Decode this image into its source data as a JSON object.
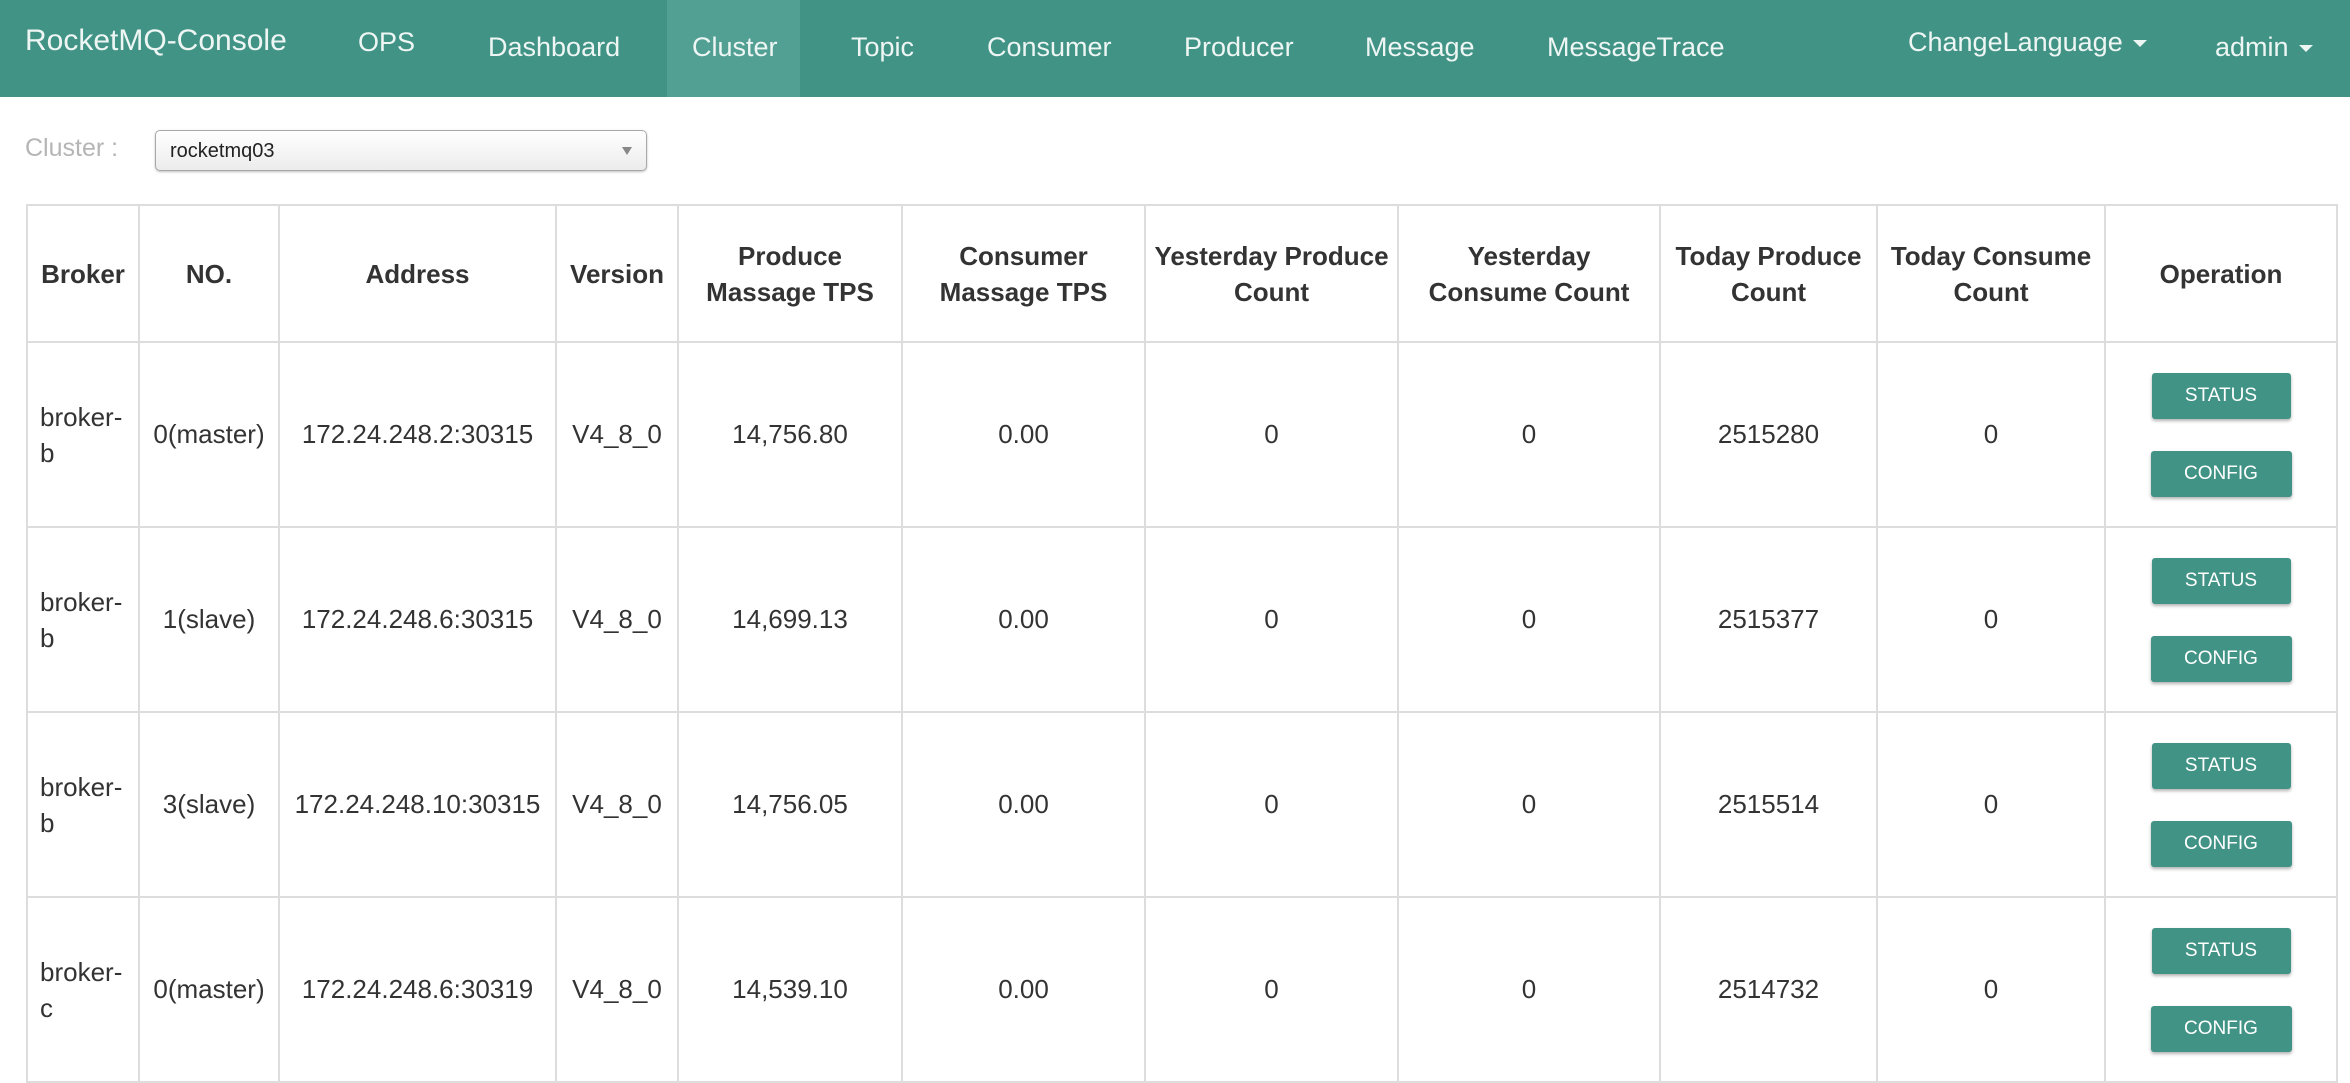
{
  "navbar": {
    "brand": "RocketMQ-Console",
    "items": [
      {
        "label": "OPS"
      },
      {
        "label": "Dashboard"
      },
      {
        "label": "Cluster",
        "active": true
      },
      {
        "label": "Topic"
      },
      {
        "label": "Consumer"
      },
      {
        "label": "Producer"
      },
      {
        "label": "Message"
      },
      {
        "label": "MessageTrace"
      }
    ],
    "language_label": "ChangeLanguage",
    "user_label": "admin"
  },
  "filter": {
    "label": "Cluster :",
    "selected": "rocketmq03"
  },
  "table": {
    "headers": [
      "Broker",
      "NO.",
      "Address",
      "Version",
      "Produce Massage TPS",
      "Consumer Massage TPS",
      "Yesterday Produce Count",
      "Yesterday Consume Count",
      "Today Produce Count",
      "Today Consume Count",
      "Operation"
    ],
    "rows": [
      {
        "broker": "broker-b",
        "no": "0(master)",
        "address": "172.24.248.2:30315",
        "version": "V4_8_0",
        "produce_tps": "14,756.80",
        "consume_tps": "0.00",
        "yesterday_produce": "0",
        "yesterday_consume": "0",
        "today_produce": "2515280",
        "today_consume": "0"
      },
      {
        "broker": "broker-b",
        "no": "1(slave)",
        "address": "172.24.248.6:30315",
        "version": "V4_8_0",
        "produce_tps": "14,699.13",
        "consume_tps": "0.00",
        "yesterday_produce": "0",
        "yesterday_consume": "0",
        "today_produce": "2515377",
        "today_consume": "0"
      },
      {
        "broker": "broker-b",
        "no": "3(slave)",
        "address": "172.24.248.10:30315",
        "version": "V4_8_0",
        "produce_tps": "14,756.05",
        "consume_tps": "0.00",
        "yesterday_produce": "0",
        "yesterday_consume": "0",
        "today_produce": "2515514",
        "today_consume": "0"
      },
      {
        "broker": "broker-c",
        "no": "0(master)",
        "address": "172.24.248.6:30319",
        "version": "V4_8_0",
        "produce_tps": "14,539.10",
        "consume_tps": "0.00",
        "yesterday_produce": "0",
        "yesterday_consume": "0",
        "today_produce": "2514732",
        "today_consume": "0"
      }
    ],
    "status_button": "STATUS",
    "config_button": "CONFIG"
  },
  "colors": {
    "primary": "#419386",
    "nav_active": "#52a094"
  }
}
